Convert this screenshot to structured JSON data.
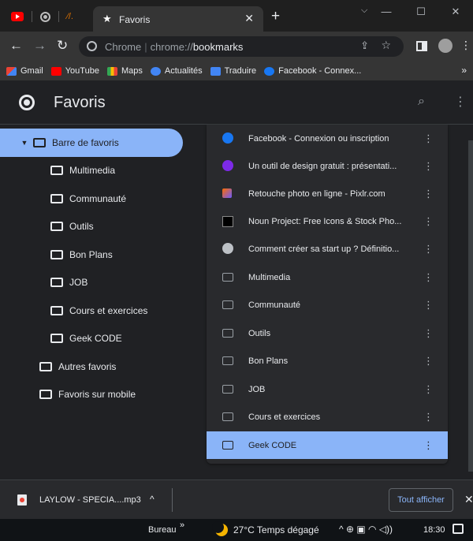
{
  "window": {
    "active_tab_title": "Favoris",
    "new_tab_symbol": "+",
    "tab_close_symbol": "✕",
    "controls": [
      "—",
      "☐",
      "✕"
    ]
  },
  "toolbar": {
    "site_label": "Chrome",
    "url_scheme": "chrome://",
    "url_host": "bookmarks"
  },
  "bookmarks_bar": {
    "items": [
      {
        "label": "Gmail",
        "icon": "gmail-icon"
      },
      {
        "label": "YouTube",
        "icon": "youtube-icon"
      },
      {
        "label": "Maps",
        "icon": "maps-icon"
      },
      {
        "label": "Actualités",
        "icon": "news-icon"
      },
      {
        "label": "Traduire",
        "icon": "translate-icon"
      },
      {
        "label": "Facebook - Connex...",
        "icon": "facebook-icon"
      }
    ],
    "more": "»"
  },
  "page": {
    "title": "Favoris"
  },
  "tree": {
    "root": "Barre de favoris",
    "children": [
      "Multimedia",
      "Communauté",
      "Outils",
      "Bon Plans",
      "JOB",
      "Cours et exercices",
      "Geek CODE"
    ],
    "others": [
      "Autres favoris",
      "Favoris sur mobile"
    ]
  },
  "list": {
    "items": [
      {
        "label": "Facebook - Connexion ou inscription",
        "kind": "link",
        "icon": "facebook-icon",
        "color": "#1877f2"
      },
      {
        "label": "Un outil de design gratuit : présentati...",
        "kind": "link",
        "icon": "canva-icon",
        "color": "#7d2ae8"
      },
      {
        "label": "Retouche photo en ligne - Pixlr.com",
        "kind": "link",
        "icon": "pixlr-icon",
        "color": "#6b5bff"
      },
      {
        "label": "Noun Project: Free Icons & Stock Pho...",
        "kind": "link",
        "icon": "noun-project-icon",
        "color": "#000000"
      },
      {
        "label": "Comment créer sa start up ? Définitio...",
        "kind": "link",
        "icon": "globe-icon",
        "color": "#bdc1c6"
      },
      {
        "label": "Multimedia",
        "kind": "folder",
        "icon": "folder-icon"
      },
      {
        "label": "Communauté",
        "kind": "folder",
        "icon": "folder-icon"
      },
      {
        "label": "Outils",
        "kind": "folder",
        "icon": "folder-icon"
      },
      {
        "label": "Bon Plans",
        "kind": "folder",
        "icon": "folder-icon"
      },
      {
        "label": "JOB",
        "kind": "folder",
        "icon": "folder-icon"
      },
      {
        "label": "Cours et exercices",
        "kind": "folder",
        "icon": "folder-icon"
      },
      {
        "label": "Geek CODE",
        "kind": "folder",
        "icon": "folder-icon",
        "selected": true
      }
    ]
  },
  "download": {
    "filename": "LAYLOW - SPECIA....mp3",
    "show_all": "Tout afficher"
  },
  "taskbar": {
    "bureau": "Bureau",
    "chevrons": "»",
    "weather": "27°C  Temps dégagé",
    "time": "18:30"
  },
  "colors": {
    "accent": "#8ab4f8",
    "background": "#202124"
  }
}
